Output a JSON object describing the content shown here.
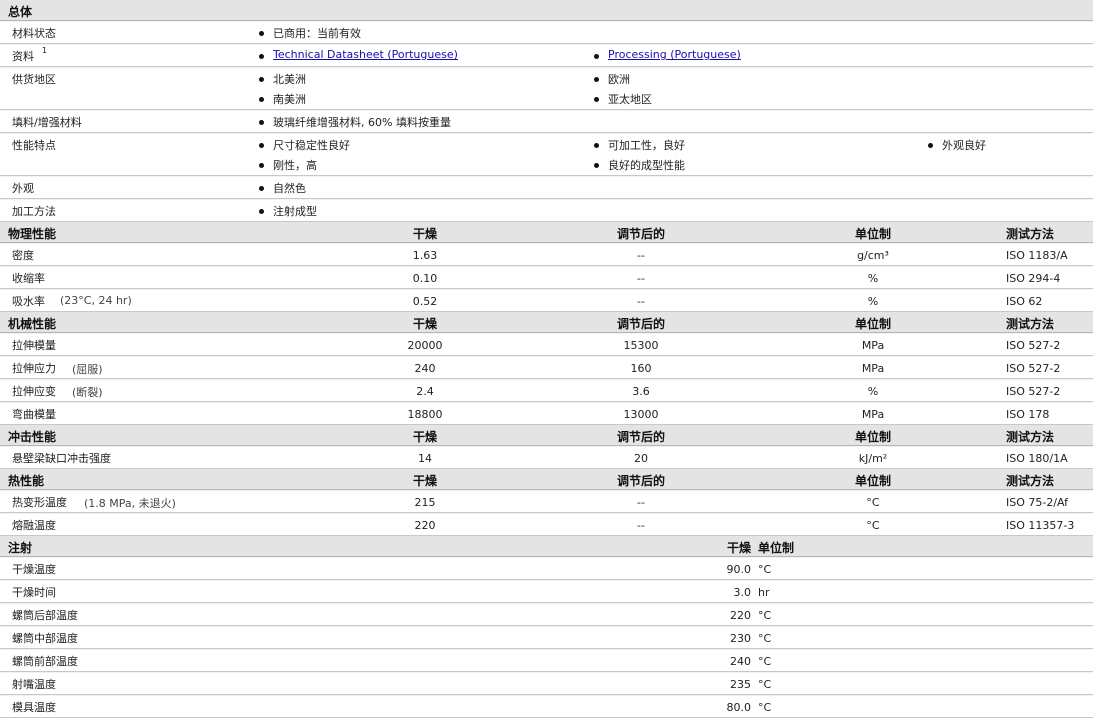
{
  "general": {
    "title": "总体",
    "rows": [
      {
        "label": "材料状态",
        "items": [
          [
            "已商用：当前有效"
          ]
        ]
      },
      {
        "label": "资料",
        "sup": "1",
        "links": [
          "Technical Datasheet (Portuguese)",
          "Processing (Portuguese)"
        ]
      },
      {
        "label": "供货地区",
        "items": [
          [
            "北美洲",
            "南美洲"
          ],
          [
            "欧洲",
            "亚太地区"
          ]
        ]
      },
      {
        "label": "填料/增强材料",
        "items": [
          [
            "玻璃纤维增强材料, 60% 填料按重量"
          ]
        ]
      },
      {
        "label": "性能特点",
        "items": [
          [
            "尺寸稳定性良好",
            "刚性，高"
          ],
          [
            "可加工性，良好",
            "良好的成型性能"
          ],
          [
            "外观良好"
          ]
        ]
      },
      {
        "label": "外观",
        "items": [
          [
            "自然色"
          ]
        ]
      },
      {
        "label": "加工方法",
        "items": [
          [
            "注射成型"
          ]
        ]
      }
    ]
  },
  "column_headers": {
    "dry": "干燥",
    "conditioned": "调节后的",
    "unit": "单位制",
    "method": "测试方法"
  },
  "sections": [
    {
      "title": "物理性能",
      "rows": [
        {
          "label": "密度",
          "dry": "1.63",
          "cond": "--",
          "unit": "g/cm³",
          "method": "ISO 1183/A"
        },
        {
          "label": "收缩率",
          "dry": "0.10",
          "cond": "--",
          "unit": "%",
          "method": "ISO 294-4"
        },
        {
          "label": "吸水率",
          "note": "(23°C, 24 hr)",
          "dry": "0.52",
          "cond": "--",
          "unit": "%",
          "method": "ISO 62"
        }
      ]
    },
    {
      "title": "机械性能",
      "rows": [
        {
          "label": "拉伸模量",
          "dry": "20000",
          "cond": "15300",
          "unit": "MPa",
          "method": "ISO 527-2"
        },
        {
          "label": "拉伸应力",
          "note": "(屈服)",
          "dry": "240",
          "cond": "160",
          "unit": "MPa",
          "method": "ISO 527-2"
        },
        {
          "label": "拉伸应变",
          "note": "(断裂)",
          "dry": "2.4",
          "cond": "3.6",
          "unit": "%",
          "method": "ISO 527-2"
        },
        {
          "label": "弯曲模量",
          "dry": "18800",
          "cond": "13000",
          "unit": "MPa",
          "method": "ISO 178"
        }
      ]
    },
    {
      "title": "冲击性能",
      "rows": [
        {
          "label": "悬壁梁缺口冲击强度",
          "dry": "14",
          "cond": "20",
          "unit": "kJ/m²",
          "method": "ISO 180/1A"
        }
      ]
    },
    {
      "title": "热性能",
      "rows": [
        {
          "label": "热变形温度",
          "note": "(1.8 MPa, 未退火)",
          "dry": "215",
          "cond": "--",
          "unit": "°C",
          "method": "ISO 75-2/Af"
        },
        {
          "label": "熔融温度",
          "dry": "220",
          "cond": "--",
          "unit": "°C",
          "method": "ISO 11357-3"
        }
      ]
    }
  ],
  "injection": {
    "title": "注射",
    "dry_header": "干燥",
    "unit_header": "单位制",
    "rows": [
      {
        "label": "干燥温度",
        "value": "90.0",
        "unit": "°C"
      },
      {
        "label": "干燥时间",
        "value": "3.0",
        "unit": "hr"
      },
      {
        "label": "螺筒后部温度",
        "value": "220",
        "unit": "°C"
      },
      {
        "label": "螺筒中部温度",
        "value": "230",
        "unit": "°C"
      },
      {
        "label": "螺筒前部温度",
        "value": "240",
        "unit": "°C"
      },
      {
        "label": "射嘴温度",
        "value": "235",
        "unit": "°C"
      },
      {
        "label": "模具温度",
        "value": "80.0",
        "unit": "°C"
      }
    ]
  }
}
